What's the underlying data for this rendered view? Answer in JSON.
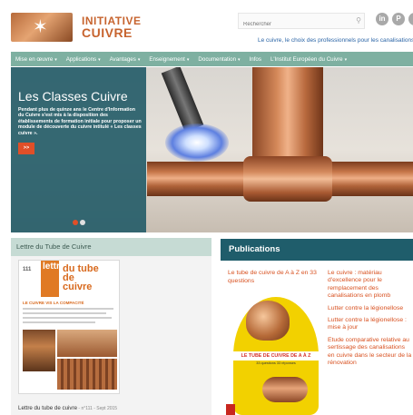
{
  "header": {
    "brand_line1": "INITIATIVE",
    "brand_line2": "CUIVRE",
    "tagline": "Le cuivre, le choix des professionnels pour les canalisations",
    "search": {
      "placeholder": "Rechercher"
    },
    "social": [
      {
        "name": "linkedin",
        "glyph": "in"
      },
      {
        "name": "pinterest",
        "glyph": "P"
      },
      {
        "name": "other",
        "glyph": ""
      }
    ]
  },
  "nav": {
    "items": [
      {
        "label": "Mise en œuvre",
        "has_menu": true
      },
      {
        "label": "Applications",
        "has_menu": true
      },
      {
        "label": "Avantages",
        "has_menu": true
      },
      {
        "label": "Enseignement",
        "has_menu": true
      },
      {
        "label": "Documentation",
        "has_menu": true
      },
      {
        "label": "Infos",
        "has_menu": false
      },
      {
        "label": "L'Institut Européen du Cuivre",
        "has_menu": true
      }
    ],
    "caret": "▾"
  },
  "hero": {
    "title": "Les Classes Cuivre",
    "text": "Pendant plus de quinze ans le Centre d'Information du Cuivre s'est mis à la disposition des établissements de formation initiale pour proposer un module de découverte du cuivre intitulé « Les classes cuivre ».",
    "button_label": ">>",
    "slides": 2,
    "active_slide": 1
  },
  "lettre": {
    "heading": "Lettre du Tube de Cuivre",
    "cover": {
      "logo": "111",
      "word": "lettre",
      "title_line1": "du tube",
      "title_line2": "de",
      "title_line3": "cuivre",
      "subtitle": "LE CUIVRE VIS LA COMPACITÉ"
    },
    "caption": "Lettre du tube de cuivre",
    "issue": " - n°111 - Sept 2015"
  },
  "publications": {
    "heading": "Publications",
    "book_title": "Le tube de cuivre de A à Z en 33 questions",
    "book_band": "LE TUBE DE CUIVRE DE A À Z",
    "book_sub": "33 questions 33 réponses",
    "links": [
      "Le cuivre : matériau d'excellence pour le remplacement des canalisations en plomb",
      "Lutter contre la légionellose",
      "Lutter contre la légionellose : mise à jour",
      "Etude comparative relative au sertissage des canalisations en cuivre dans le secteur de la rénovation"
    ]
  },
  "colors": {
    "brand_orange": "#c7642f",
    "nav_green": "#7eb0a1",
    "overlay_teal": "#265d69",
    "button_orange": "#e04f28",
    "pub_header": "#1f5d6b",
    "link_orange": "#d8501f",
    "tagline_blue": "#2a64a6"
  }
}
